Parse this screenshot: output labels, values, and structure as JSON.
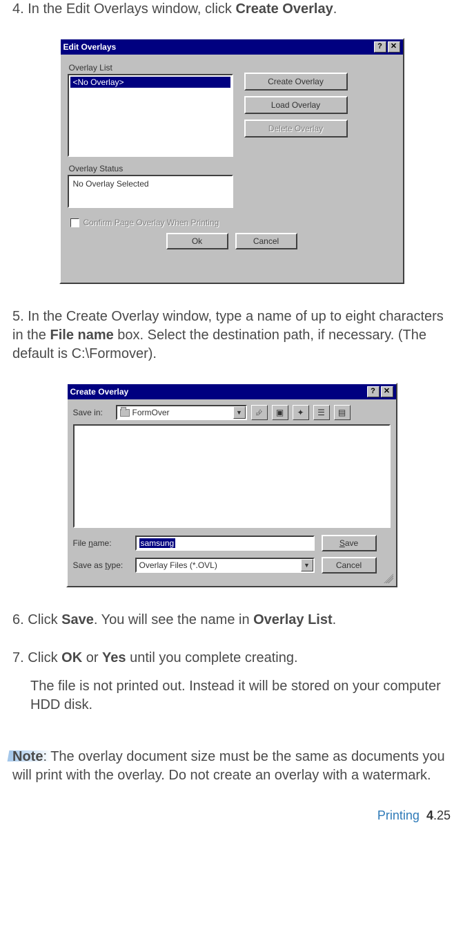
{
  "steps": {
    "s4_num": "4.",
    "s4_a": " In the Edit Overlays window, click ",
    "s4_bold": "Create Overlay",
    "s4_c": ".",
    "s5_num": "5.",
    "s5_a": " In the Create Overlay window, type a name of up to eight characters in the ",
    "s5_bold": "File name",
    "s5_b": " box. Select the destination path, if necessary. (The default is C:\\Formover).",
    "s6_num": "6.",
    "s6_a": " Click ",
    "s6_b1": "Save",
    "s6_b": ". You will see the name in ",
    "s6_b2": "Overlay List",
    "s6_c": ".",
    "s7_num": "7.",
    "s7_a": " Click ",
    "s7_b1": "OK",
    "s7_m": " or ",
    "s7_b2": "Yes",
    "s7_b": " until you complete creating.",
    "s7_p2": "The file is not printed out. Instead it will be stored on your computer HDD disk."
  },
  "note": {
    "label": "Note",
    "sep": ": ",
    "text": "The overlay document size must be the same as documents you will print with the overlay. Do not create an overlay with a watermark."
  },
  "footer": {
    "section": "Printing",
    "page_chapter": "4",
    "page_dot": ".",
    "page_num": "25"
  },
  "edit_overlays": {
    "title": "Edit Overlays",
    "help_glyph": "?",
    "close_glyph": "✕",
    "overlay_list_label": "Overlay List",
    "list_item": "<No Overlay>",
    "btn_create": "Create Overlay",
    "btn_load": "Load Overlay",
    "btn_delete": "Delete Overlay",
    "status_label": "Overlay Status",
    "status_value": "No Overlay Selected",
    "confirm_label": "Confirm Page Overlay When Printing",
    "btn_ok": "Ok",
    "btn_cancel": "Cancel"
  },
  "create_overlay": {
    "title": "Create Overlay",
    "help_glyph": "?",
    "close_glyph": "✕",
    "save_in_label": "Save in:",
    "save_in_value": "FormOver",
    "dropdown_glyph": "▼",
    "toolbar": {
      "up": "⮵",
      "desktop": "▣",
      "newfolder": "✦",
      "list": "☰",
      "details": "▤"
    },
    "filename_l1": "File ",
    "filename_u": "n",
    "filename_l2": "ame:",
    "filename_value": "samsung",
    "saveas_l1": "Save as ",
    "saveas_u": "t",
    "saveas_l2": "ype:",
    "saveas_value": "Overlay Files (*.OVL)",
    "btn_save_u": "S",
    "btn_save_r": "ave",
    "btn_cancel": "Cancel"
  }
}
